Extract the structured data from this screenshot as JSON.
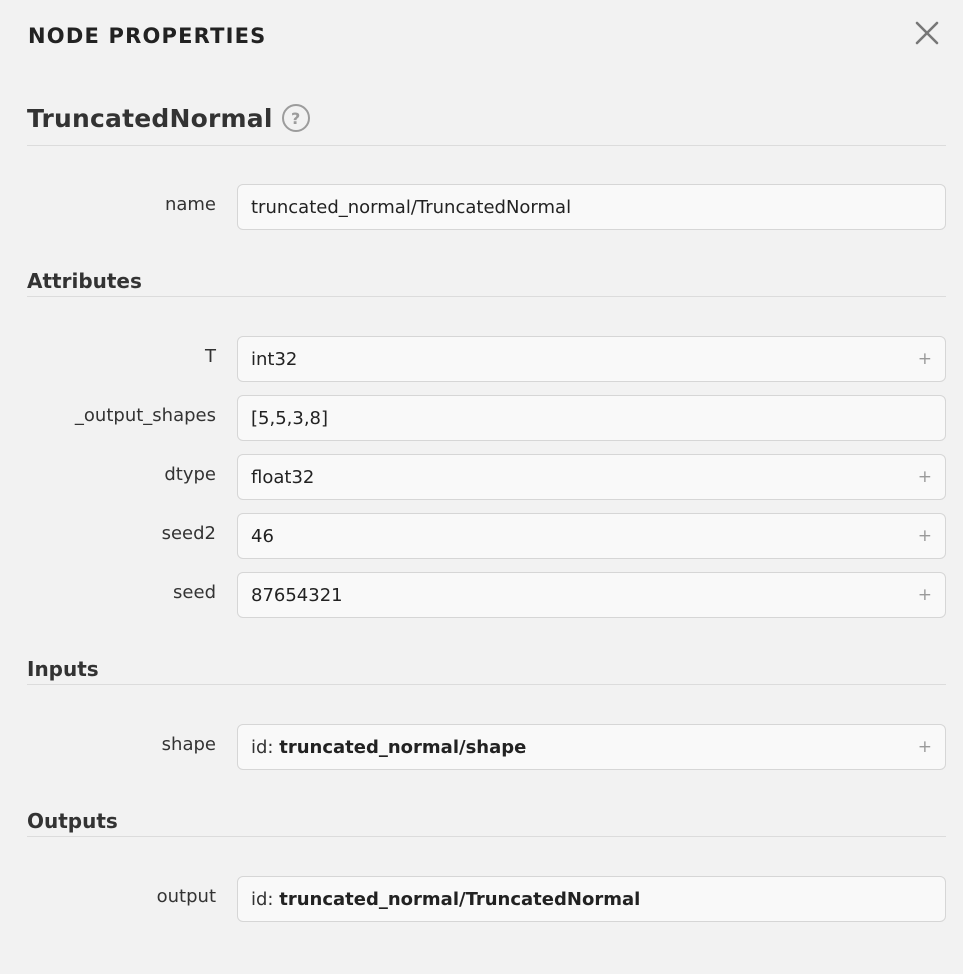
{
  "panel": {
    "title": "NODE PROPERTIES"
  },
  "node": {
    "type": "TruncatedNormal",
    "help_symbol": "?",
    "name_label": "name",
    "name_value": "truncated_normal/TruncatedNormal"
  },
  "attributes": {
    "title": "Attributes",
    "items": [
      {
        "label": "T",
        "value": "int32",
        "expandable": true
      },
      {
        "label": "_output_shapes",
        "value": "[5,5,3,8]",
        "expandable": false
      },
      {
        "label": "dtype",
        "value": "float32",
        "expandable": true
      },
      {
        "label": "seed2",
        "value": "46",
        "expandable": true
      },
      {
        "label": "seed",
        "value": "87654321",
        "expandable": true
      }
    ]
  },
  "inputs": {
    "title": "Inputs",
    "items": [
      {
        "label": "shape",
        "id_prefix": "id:",
        "id_value": "truncated_normal/shape",
        "expandable": true
      }
    ]
  },
  "outputs": {
    "title": "Outputs",
    "items": [
      {
        "label": "output",
        "id_prefix": "id:",
        "id_value": "truncated_normal/TruncatedNormal",
        "expandable": false
      }
    ]
  },
  "icons": {
    "close": "close-icon",
    "help": "help-icon",
    "expand": "plus-icon"
  },
  "expand_symbol": "+"
}
